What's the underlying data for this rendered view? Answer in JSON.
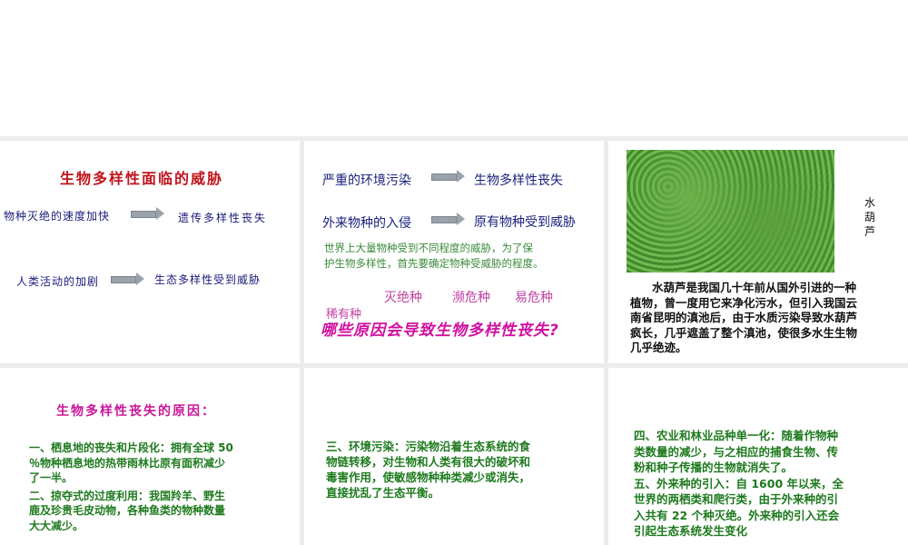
{
  "slide1": {
    "title": "生物多样性面临的威胁",
    "row1_left": "物种灭绝的速度加快",
    "row1_right": "遗传多样性丧失",
    "row2_left": "人类活动的加剧",
    "row2_right": "生态多样性受到威胁"
  },
  "slide2": {
    "row1_left": "严重的环境污染",
    "row1_right": "生物多样性丧失",
    "row2_left": "外来物种的入侵",
    "row2_right": "原有物种受到威胁",
    "note_lines": [
      "世界上大量物种受到不同程度的威胁，为了保",
      "护生物多样性，首先要确定物种受威胁的程度。"
    ],
    "cat1": "灭绝种",
    "cat2": "濒危种",
    "cat3": "易危种",
    "cat4": "稀有种",
    "question": "哪些原因会导致生物多样性丧失?"
  },
  "slide3": {
    "image_label": "水葫芦",
    "text_lines": [
      "水葫芦是我国几十年前从国外引进的一种",
      "植物，曾一度用它来净化污水，但引入我国云",
      "南省昆明的滇池后，由于水质污染导致水葫芦",
      "疯长，几乎遮盖了整个滇池，使很多水生生物",
      "几乎绝迹。"
    ]
  },
  "slide4": {
    "title": "生物多样性丧失的原因：",
    "p1_lines": [
      "一、栖息地的丧失和片段化：拥有全球 50",
      "％物种栖息地的热带雨林比原有面积减少",
      "了一半。"
    ],
    "p2_lines": [
      "二、掠夺式的过度利用：我国羚羊、野生",
      "鹿及珍贵毛皮动物，各种鱼类的物种数量",
      "大大减少。"
    ]
  },
  "slide5": {
    "p_lines": [
      "三、环境污染：污染物沿着生态系统的食",
      "物链转移，对生物和人类有很大的破坏和",
      "毒害作用，使敏感物种种类减少或消失，",
      "直接扰乱了生态平衡。"
    ]
  },
  "slide6": {
    "p1_lines": [
      "四、农业和林业品种单一化：随着作物种",
      "类数量的减少，与之相应的捕食生物、传",
      "粉和种子传播的生物就消失了。"
    ],
    "p2_lines": [
      "五、外来种的引入：自 1600 年以来，全",
      "世界的两栖类和爬行类，由于外来种的引",
      "入共有 22 个种灭绝。外来种的引入还会",
      "引起生态系统发生变化"
    ]
  }
}
